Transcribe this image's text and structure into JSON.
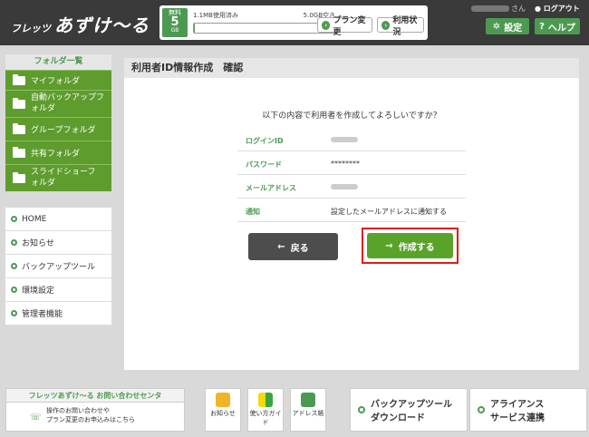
{
  "header": {
    "logo_small": "フレッツ",
    "logo_large": "あずけ〜る",
    "plan": {
      "label": "無料",
      "size": "5",
      "unit": "GB"
    },
    "usage_text": "1.1MB使用済み",
    "free_text": "5.0GB空き",
    "usage_fraction": 0.005,
    "plan_change": "プラン変更",
    "usage_status": "利用状況",
    "user_suffix": "さん",
    "logout": "ログアウト",
    "settings": "設定",
    "help": "ヘルプ"
  },
  "sidebar": {
    "folder_head": "フォルダ一覧",
    "folders": [
      {
        "label": "マイフォルダ"
      },
      {
        "label": "自動バックアップフォルダ"
      },
      {
        "label": "グループフォルダ"
      },
      {
        "label": "共有フォルダ"
      },
      {
        "label": "スライドショーフォルダ"
      }
    ],
    "menu": [
      {
        "label": "HOME"
      },
      {
        "label": "お知らせ"
      },
      {
        "label": "バックアップツール"
      },
      {
        "label": "環境設定"
      },
      {
        "label": "管理者機能"
      }
    ]
  },
  "main": {
    "title": "利用者ID情報作成　確認",
    "question": "以下の内容で利用者を作成してよろしいですか？",
    "rows": [
      {
        "label": "ログインID",
        "value": ""
      },
      {
        "label": "パスワード",
        "value": "********"
      },
      {
        "label": "メールアドレス",
        "value": ""
      },
      {
        "label": "通知",
        "value": "設定したメールアドレスに通知する"
      }
    ],
    "back": "戻る",
    "create": "作成する"
  },
  "footer": {
    "contact_title": "フレッツあずけ〜る お問い合わせセンタ",
    "contact_line1": "操作のお問い合わせや",
    "contact_line2": "プラン変更のお申込みはこちら",
    "tiles": [
      {
        "label": "お知らせ",
        "icon": "megaphone-icon"
      },
      {
        "label": "使い方ガイド",
        "icon": "beginner-mark-icon"
      },
      {
        "label": "アドレス帳",
        "icon": "address-book-icon"
      }
    ],
    "backup_tool_line1": "バックアップツール",
    "backup_tool_line2": "ダウンロード",
    "alliance_line1": "アライアンス",
    "alliance_line2": "サービス連携"
  },
  "colors": {
    "brand_green": "#4c9a52",
    "header_dark": "#3a3a3a",
    "highlight_red": "#e01b1b"
  }
}
